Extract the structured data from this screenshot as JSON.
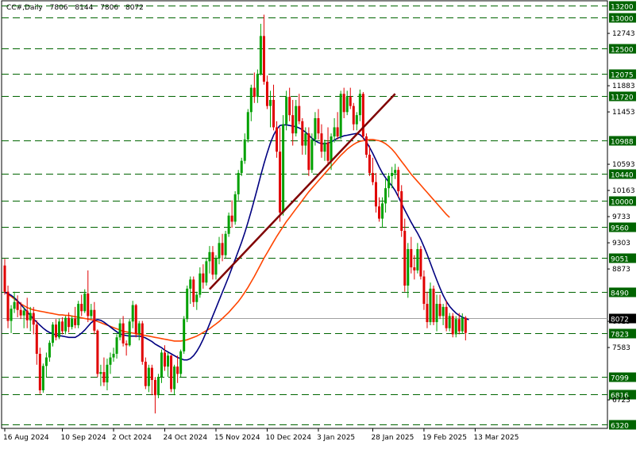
{
  "header": {
    "symbol": "CC#,Daily",
    "open": "7806",
    "high": "8144",
    "low": "7806",
    "close": "8072"
  },
  "colors": {
    "bull": "#00a000",
    "bear": "#e00000",
    "ma_fast": "#000080",
    "ma_slow": "#ff4500",
    "trendline": "#800000",
    "grid": "#006400",
    "label_bg": "#006400",
    "price_bg": "#000000"
  },
  "chart_data": {
    "type": "candlestick",
    "y_ticks": [
      "12743",
      "11883",
      "11453",
      "10593",
      "10163",
      "9733",
      "9303",
      "8873",
      "8013",
      "7583",
      "6723"
    ],
    "levels": [
      {
        "value": 13200,
        "label": "13200"
      },
      {
        "value": 13000,
        "label": "13000"
      },
      {
        "value": 12500,
        "label": "12500"
      },
      {
        "value": 12075,
        "label": "12075"
      },
      {
        "value": 11720,
        "label": "11720"
      },
      {
        "value": 10988,
        "label": "10988"
      },
      {
        "value": 10440,
        "label": "10440"
      },
      {
        "value": 10000,
        "label": "10000"
      },
      {
        "value": 9560,
        "label": "9560"
      },
      {
        "value": 9051,
        "label": "9051"
      },
      {
        "value": 8490,
        "label": "8490"
      },
      {
        "value": 7823,
        "label": "7823"
      },
      {
        "value": 7099,
        "label": "7099"
      },
      {
        "value": 6816,
        "label": "6816"
      },
      {
        "value": 6320,
        "label": "6320"
      }
    ],
    "current_price": {
      "value": 8072,
      "label": "8072"
    },
    "x_labels": [
      {
        "index": 0,
        "label": "16 Aug 2024"
      },
      {
        "index": 18,
        "label": "10 Sep 2024"
      },
      {
        "index": 34,
        "label": "2 Oct 2024"
      },
      {
        "index": 50,
        "label": "24 Oct 2024"
      },
      {
        "index": 66,
        "label": "15 Nov 2024"
      },
      {
        "index": 82,
        "label": "10 Dec 2024"
      },
      {
        "index": 98,
        "label": "3 Jan 2025"
      },
      {
        "index": 115,
        "label": "28 Jan 2025"
      },
      {
        "index": 131,
        "label": "19 Feb 2025"
      },
      {
        "index": 147,
        "label": "13 Mar 2025"
      }
    ],
    "candles": [
      [
        8930,
        9040,
        8450,
        8500
      ],
      [
        8500,
        8600,
        7900,
        8020
      ],
      [
        8020,
        8280,
        7820,
        8220
      ],
      [
        8220,
        8500,
        8150,
        8330
      ],
      [
        8330,
        8440,
        8080,
        8200
      ],
      [
        8200,
        8330,
        8050,
        8110
      ],
      [
        8110,
        8250,
        7900,
        8190
      ],
      [
        8190,
        8400,
        7900,
        8030
      ],
      [
        8030,
        8250,
        7850,
        8150
      ],
      [
        8150,
        8250,
        7800,
        7960
      ],
      [
        7960,
        8030,
        7300,
        7480
      ],
      [
        7480,
        7580,
        6820,
        6880
      ],
      [
        6880,
        7320,
        6840,
        7280
      ],
      [
        7280,
        7500,
        7100,
        7420
      ],
      [
        7420,
        7700,
        7350,
        7660
      ],
      [
        7660,
        8000,
        7600,
        7960
      ],
      [
        7960,
        8050,
        7700,
        7750
      ],
      [
        7750,
        8060,
        7720,
        8010
      ],
      [
        8010,
        8080,
        7800,
        7850
      ],
      [
        7850,
        8100,
        7800,
        8070
      ],
      [
        8070,
        8160,
        7830,
        7920
      ],
      [
        7920,
        8100,
        7880,
        8060
      ],
      [
        8060,
        8250,
        7900,
        7950
      ],
      [
        7950,
        8350,
        7900,
        8300
      ],
      [
        8300,
        8450,
        8100,
        8180
      ],
      [
        8180,
        8540,
        8150,
        8470
      ],
      [
        8470,
        8850,
        8000,
        8100
      ],
      [
        8100,
        8300,
        8050,
        8200
      ],
      [
        8200,
        8330,
        7800,
        7860
      ],
      [
        7860,
        7880,
        7100,
        7150
      ],
      [
        7150,
        7300,
        6950,
        7180
      ],
      [
        7180,
        7420,
        6950,
        7010
      ],
      [
        7010,
        7400,
        6880,
        7300
      ],
      [
        7300,
        7500,
        7150,
        7420
      ],
      [
        7420,
        7580,
        7350,
        7480
      ],
      [
        7480,
        7800,
        7400,
        7750
      ],
      [
        7750,
        8050,
        7700,
        7980
      ],
      [
        7980,
        8100,
        7600,
        7650
      ],
      [
        7650,
        7700,
        7450,
        7620
      ],
      [
        7620,
        8050,
        7600,
        8010
      ],
      [
        8010,
        8350,
        7900,
        8280
      ],
      [
        8280,
        8300,
        7750,
        7810
      ],
      [
        7810,
        8020,
        7700,
        7980
      ],
      [
        7980,
        8020,
        7300,
        7350
      ],
      [
        7350,
        7420,
        6900,
        6950
      ],
      [
        6950,
        7300,
        6850,
        7250
      ],
      [
        7250,
        7300,
        6800,
        7050
      ],
      [
        7050,
        7100,
        6500,
        6800
      ],
      [
        6800,
        7150,
        6750,
        7100
      ],
      [
        7100,
        7550,
        7000,
        7500
      ],
      [
        7500,
        7620,
        7200,
        7270
      ],
      [
        7270,
        7500,
        7100,
        7450
      ],
      [
        7450,
        7460,
        6850,
        6900
      ],
      [
        6900,
        7300,
        6800,
        7270
      ],
      [
        7270,
        7450,
        7000,
        7150
      ],
      [
        7150,
        7550,
        7100,
        7520
      ],
      [
        7520,
        8100,
        7480,
        8050
      ],
      [
        8050,
        8600,
        8000,
        8550
      ],
      [
        8550,
        8750,
        8300,
        8700
      ],
      [
        8700,
        8750,
        8250,
        8330
      ],
      [
        8330,
        8500,
        8200,
        8450
      ],
      [
        8450,
        8900,
        8400,
        8800
      ],
      [
        8800,
        8950,
        8550,
        8650
      ],
      [
        8650,
        9050,
        8600,
        9000
      ],
      [
        9000,
        9250,
        8800,
        9150
      ],
      [
        9150,
        9250,
        8700,
        8780
      ],
      [
        8780,
        9100,
        8700,
        9050
      ],
      [
        9050,
        9400,
        8950,
        9300
      ],
      [
        9300,
        9450,
        9000,
        9100
      ],
      [
        9100,
        9500,
        9050,
        9450
      ],
      [
        9450,
        9800,
        9400,
        9750
      ],
      [
        9750,
        10000,
        9550,
        9650
      ],
      [
        9650,
        10150,
        9600,
        10100
      ],
      [
        10100,
        10500,
        10000,
        10450
      ],
      [
        10450,
        10700,
        10400,
        10650
      ],
      [
        10650,
        11100,
        10600,
        11000
      ],
      [
        11000,
        11500,
        10950,
        11450
      ],
      [
        11450,
        11900,
        11300,
        11850
      ],
      [
        11850,
        12100,
        11600,
        11700
      ],
      [
        11700,
        12150,
        11600,
        12080
      ],
      [
        12080,
        12900,
        12050,
        12700
      ],
      [
        12700,
        13050,
        11900,
        11950
      ],
      [
        11950,
        12050,
        11500,
        11550
      ],
      [
        11550,
        11800,
        11200,
        11650
      ],
      [
        11650,
        11900,
        11150,
        11200
      ],
      [
        11200,
        11300,
        10700,
        10800
      ],
      [
        10800,
        11200,
        9650,
        9800
      ],
      [
        9800,
        11400,
        9750,
        11250
      ],
      [
        11250,
        11800,
        11150,
        11700
      ],
      [
        11700,
        11850,
        11300,
        11400
      ],
      [
        11400,
        11650,
        10900,
        11100
      ],
      [
        11100,
        11650,
        11050,
        11550
      ],
      [
        11550,
        11750,
        11250,
        11300
      ],
      [
        11300,
        11350,
        10750,
        10900
      ],
      [
        10900,
        11200,
        10750,
        11100
      ],
      [
        11100,
        11200,
        10400,
        10500
      ],
      [
        10500,
        11100,
        10450,
        11000
      ],
      [
        11000,
        11450,
        10900,
        11350
      ],
      [
        11350,
        11500,
        11000,
        11100
      ],
      [
        11100,
        11250,
        10700,
        10800
      ],
      [
        10800,
        11000,
        10650,
        10950
      ],
      [
        10950,
        11200,
        10600,
        10650
      ],
      [
        10650,
        11100,
        10500,
        11050
      ],
      [
        11050,
        11350,
        10950,
        11200
      ],
      [
        11200,
        11450,
        11000,
        11050
      ],
      [
        11050,
        11800,
        11000,
        11750
      ],
      [
        11750,
        11850,
        11350,
        11450
      ],
      [
        11450,
        11800,
        11400,
        11700
      ],
      [
        11700,
        11850,
        11500,
        11550
      ],
      [
        11550,
        11600,
        11150,
        11250
      ],
      [
        11250,
        11450,
        11150,
        11400
      ],
      [
        11400,
        11820,
        11300,
        11750
      ],
      [
        11750,
        11780,
        11000,
        11050
      ],
      [
        11050,
        11100,
        10700,
        10750
      ],
      [
        10750,
        10900,
        10400,
        10450
      ],
      [
        10450,
        10700,
        10250,
        10300
      ],
      [
        10300,
        10450,
        9800,
        9900
      ],
      [
        9900,
        10050,
        9650,
        9700
      ],
      [
        9700,
        10050,
        9550,
        9950
      ],
      [
        9950,
        10350,
        9800,
        10200
      ],
      [
        10200,
        10450,
        10050,
        10400
      ],
      [
        10400,
        10550,
        10200,
        10450
      ],
      [
        10450,
        10600,
        10350,
        10500
      ],
      [
        10500,
        10550,
        10050,
        10150
      ],
      [
        10150,
        10250,
        9400,
        9500
      ],
      [
        9500,
        9700,
        8500,
        8600
      ],
      [
        8600,
        9300,
        8400,
        9200
      ],
      [
        9200,
        9400,
        8800,
        8900
      ],
      [
        8900,
        9100,
        8700,
        8850
      ],
      [
        8850,
        9300,
        8800,
        9200
      ],
      [
        9200,
        9250,
        8700,
        8750
      ],
      [
        8750,
        8850,
        8200,
        8300
      ],
      [
        8300,
        8500,
        7900,
        8000
      ],
      [
        8000,
        8650,
        7950,
        8550
      ],
      [
        8550,
        8600,
        7950,
        8000
      ],
      [
        8000,
        8450,
        7850,
        8300
      ],
      [
        8300,
        8450,
        8050,
        8100
      ],
      [
        8100,
        8300,
        7950,
        8250
      ],
      [
        8250,
        8350,
        7850,
        7900
      ],
      [
        7900,
        8150,
        7850,
        8100
      ],
      [
        8100,
        8150,
        7750,
        7800
      ],
      [
        7800,
        8100,
        7750,
        8050
      ],
      [
        8050,
        8150,
        7800,
        7850
      ],
      [
        7850,
        8144,
        7806,
        8072
      ],
      [
        8072,
        8100,
        7700,
        7823
      ]
    ],
    "ma_fast": [
      8490,
      8470,
      8440,
      8400,
      8350,
      8290,
      8230,
      8170,
      8110,
      8050,
      8000,
      7950,
      7900,
      7860,
      7830,
      7810,
      7790,
      7780,
      7770,
      7760,
      7750,
      7750,
      7750,
      7780,
      7820,
      7870,
      7930,
      7990,
      8030,
      8040,
      8030,
      8000,
      7960,
      7920,
      7880,
      7840,
      7810,
      7790,
      7780,
      7770,
      7770,
      7770,
      7770,
      7760,
      7740,
      7710,
      7680,
      7640,
      7610,
      7580,
      7540,
      7510,
      7480,
      7450,
      7420,
      7400,
      7380,
      7380,
      7400,
      7450,
      7520,
      7610,
      7720,
      7840,
      7970,
      8100,
      8230,
      8360,
      8490,
      8620,
      8750,
      8890,
      9030,
      9170,
      9310,
      9470,
      9640,
      9820,
      10010,
      10210,
      10410,
      10600,
      10780,
      10940,
      11070,
      11170,
      11230,
      11240,
      11240,
      11230,
      11220,
      11210,
      11190,
      11160,
      11120,
      11070,
      11020,
      10980,
      10950,
      10930,
      10930,
      10940,
      10960,
      10990,
      11020,
      11040,
      11060,
      11070,
      11080,
      11090,
      11100,
      11080,
      11030,
      10960,
      10870,
      10770,
      10660,
      10550,
      10450,
      10370,
      10300,
      10240,
      10160,
      10060,
      9950,
      9840,
      9740,
      9640,
      9550,
      9460,
      9360,
      9240,
      9110,
      8970,
      8830,
      8690,
      8560,
      8440,
      8340,
      8260,
      8200,
      8150,
      8110,
      8080,
      8060,
      8040
    ],
    "ma_slow": [
      8500,
      8460,
      8420,
      8380,
      8340,
      8300,
      8270,
      8240,
      8220,
      8200,
      8190,
      8180,
      8170,
      8160,
      8150,
      8140,
      8130,
      8120,
      8120,
      8110,
      8110,
      8100,
      8090,
      8080,
      8070,
      8060,
      8050,
      8040,
      8030,
      8010,
      7990,
      7970,
      7950,
      7930,
      7910,
      7890,
      7870,
      7850,
      7840,
      7830,
      7820,
      7810,
      7800,
      7790,
      7780,
      7770,
      7760,
      7750,
      7740,
      7730,
      7720,
      7710,
      7700,
      7690,
      7690,
      7690,
      7700,
      7710,
      7730,
      7750,
      7770,
      7800,
      7830,
      7860,
      7890,
      7930,
      7970,
      8010,
      8060,
      8110,
      8160,
      8220,
      8280,
      8340,
      8410,
      8490,
      8570,
      8660,
      8750,
      8850,
      8950,
      9050,
      9140,
      9230,
      9320,
      9410,
      9490,
      9570,
      9650,
      9720,
      9790,
      9860,
      9930,
      10000,
      10070,
      10140,
      10200,
      10260,
      10320,
      10380,
      10440,
      10500,
      10560,
      10620,
      10680,
      10740,
      10790,
      10840,
      10880,
      10920,
      10950,
      10970,
      10980,
      10990,
      11000,
      11000,
      10990,
      10980,
      10960,
      10930,
      10890,
      10840,
      10780,
      10710,
      10640,
      10570,
      10500,
      10430,
      10370,
      10310,
      10250,
      10190,
      10130,
      10070,
      10010,
      9950,
      9890,
      9830,
      9770,
      9720
    ],
    "trendline": [
      {
        "index": 64,
        "value": 8540
      },
      {
        "index": 122,
        "value": 11750
      }
    ]
  }
}
